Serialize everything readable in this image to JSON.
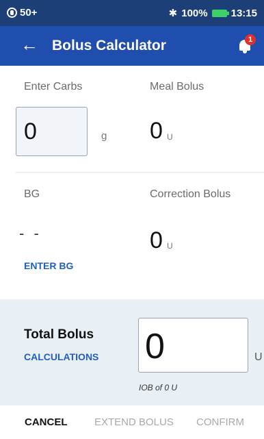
{
  "status_bar": {
    "pod_reservoir": "50+",
    "battery_percent": "100%",
    "time": "13:15",
    "icons": [
      "pod-icon",
      "bluetooth-icon",
      "battery-icon"
    ],
    "battery_color": "#3fd06a"
  },
  "app_bar": {
    "title": "Bolus Calculator",
    "notification_count": "1",
    "icons": [
      "back-arrow-icon",
      "bell-icon"
    ],
    "color": "#1f4eae"
  },
  "carbs": {
    "label": "Enter Carbs",
    "value": "0",
    "unit": "g"
  },
  "meal_bolus": {
    "label": "Meal Bolus",
    "value": "0",
    "unit": "U"
  },
  "bg": {
    "label": "BG",
    "value": "- -",
    "link": "ENTER BG"
  },
  "correction_bolus": {
    "label": "Correction Bolus",
    "value": "0",
    "unit": "U"
  },
  "total": {
    "label": "Total Bolus",
    "link": "CALCULATIONS",
    "value": "0",
    "unit": "U",
    "iob": "IOB of 0 U"
  },
  "actions": {
    "cancel": "CANCEL",
    "extend": "EXTEND BOLUS",
    "confirm": "CONFIRM"
  },
  "colors": {
    "link": "#1f5fc0",
    "status_bar": "#1d3f77",
    "panel": "#e9f0f5",
    "badge": "#e0302b"
  }
}
